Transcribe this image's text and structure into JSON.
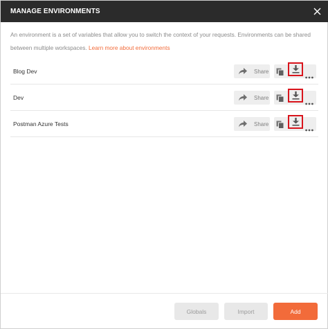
{
  "modal": {
    "title": "MANAGE ENVIRONMENTS",
    "description": "An environment is a set of variables that allow you to switch the context of your requests. Environments can be shared between multiple workspaces.",
    "learn_more_link": "Learn more about environments"
  },
  "environments": [
    {
      "name": "Blog Dev",
      "share_label": "Share"
    },
    {
      "name": "Dev",
      "share_label": "Share"
    },
    {
      "name": "Postman Azure Tests",
      "share_label": "Share"
    }
  ],
  "footer": {
    "globals_label": "Globals",
    "import_label": "Import",
    "add_label": "Add"
  },
  "colors": {
    "titlebar": "#2b2b2b",
    "accent": "#f26b3a",
    "highlight_border": "#d9141c"
  },
  "icons": {
    "close": "close-icon",
    "share": "share-arrow-icon",
    "duplicate": "duplicate-icon",
    "download": "download-icon",
    "more": "more-dots-icon"
  }
}
